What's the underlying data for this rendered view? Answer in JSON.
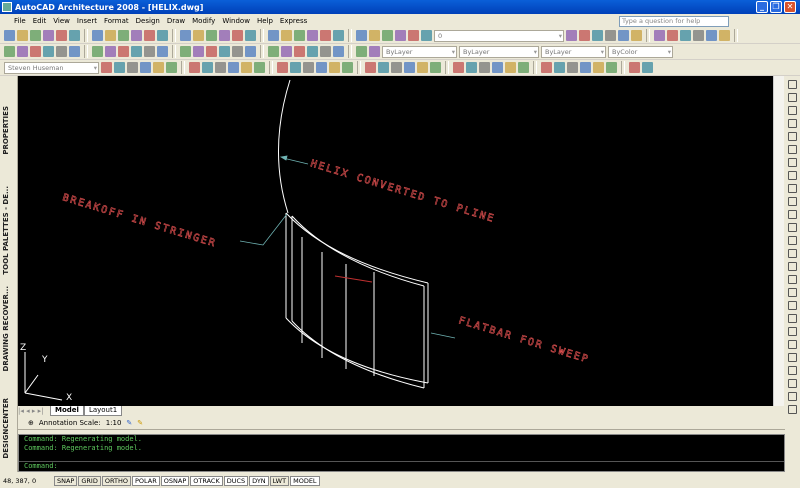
{
  "title": "AutoCAD Architecture 2008 - [HELIX.dwg]",
  "menu": [
    "File",
    "Edit",
    "View",
    "Insert",
    "Format",
    "Design",
    "Draw",
    "Modify",
    "Window",
    "Help",
    "Express"
  ],
  "help_placeholder": "Type a question for help",
  "toolbars": {
    "layer_value": "0",
    "color": "ByLayer",
    "linetype": "ByLayer",
    "lineweight": "ByLayer",
    "plotstyle": "ByColor",
    "workspace": "Steven Huseman"
  },
  "palettes": [
    "PROPERTIES",
    "TOOL PALETTES - DE...",
    "DRAWING RECOVER...",
    "DESIGNCENTER"
  ],
  "drawing": {
    "labels": [
      "HELIX CONVERTED TO PLINE",
      "BREAKOFF IN STRINGER",
      "FLATBAR FOR SWEEP"
    ],
    "ucs": {
      "x": "X",
      "y": "Y",
      "z": "Z"
    },
    "colors": {
      "background": "#000000",
      "text": "#e05050",
      "leader": "#6fb3b3",
      "geometry": "#ffffff"
    }
  },
  "tabs": [
    "Model",
    "Layout1"
  ],
  "annotation": {
    "label": "Annotation Scale:",
    "value": "1:10"
  },
  "command": {
    "history": [
      "Command:  Regenerating model.",
      "Command:  Regenerating model."
    ],
    "prompt": "Command:"
  },
  "status": {
    "coords": "48, 387, 0",
    "toggles": [
      {
        "label": "SNAP",
        "on": false
      },
      {
        "label": "GRID",
        "on": false
      },
      {
        "label": "ORTHO",
        "on": false
      },
      {
        "label": "POLAR",
        "on": true
      },
      {
        "label": "OSNAP",
        "on": true
      },
      {
        "label": "OTRACK",
        "on": true
      },
      {
        "label": "DUCS",
        "on": true
      },
      {
        "label": "DYN",
        "on": true
      },
      {
        "label": "LWT",
        "on": false
      },
      {
        "label": "MODEL",
        "on": true
      }
    ]
  }
}
